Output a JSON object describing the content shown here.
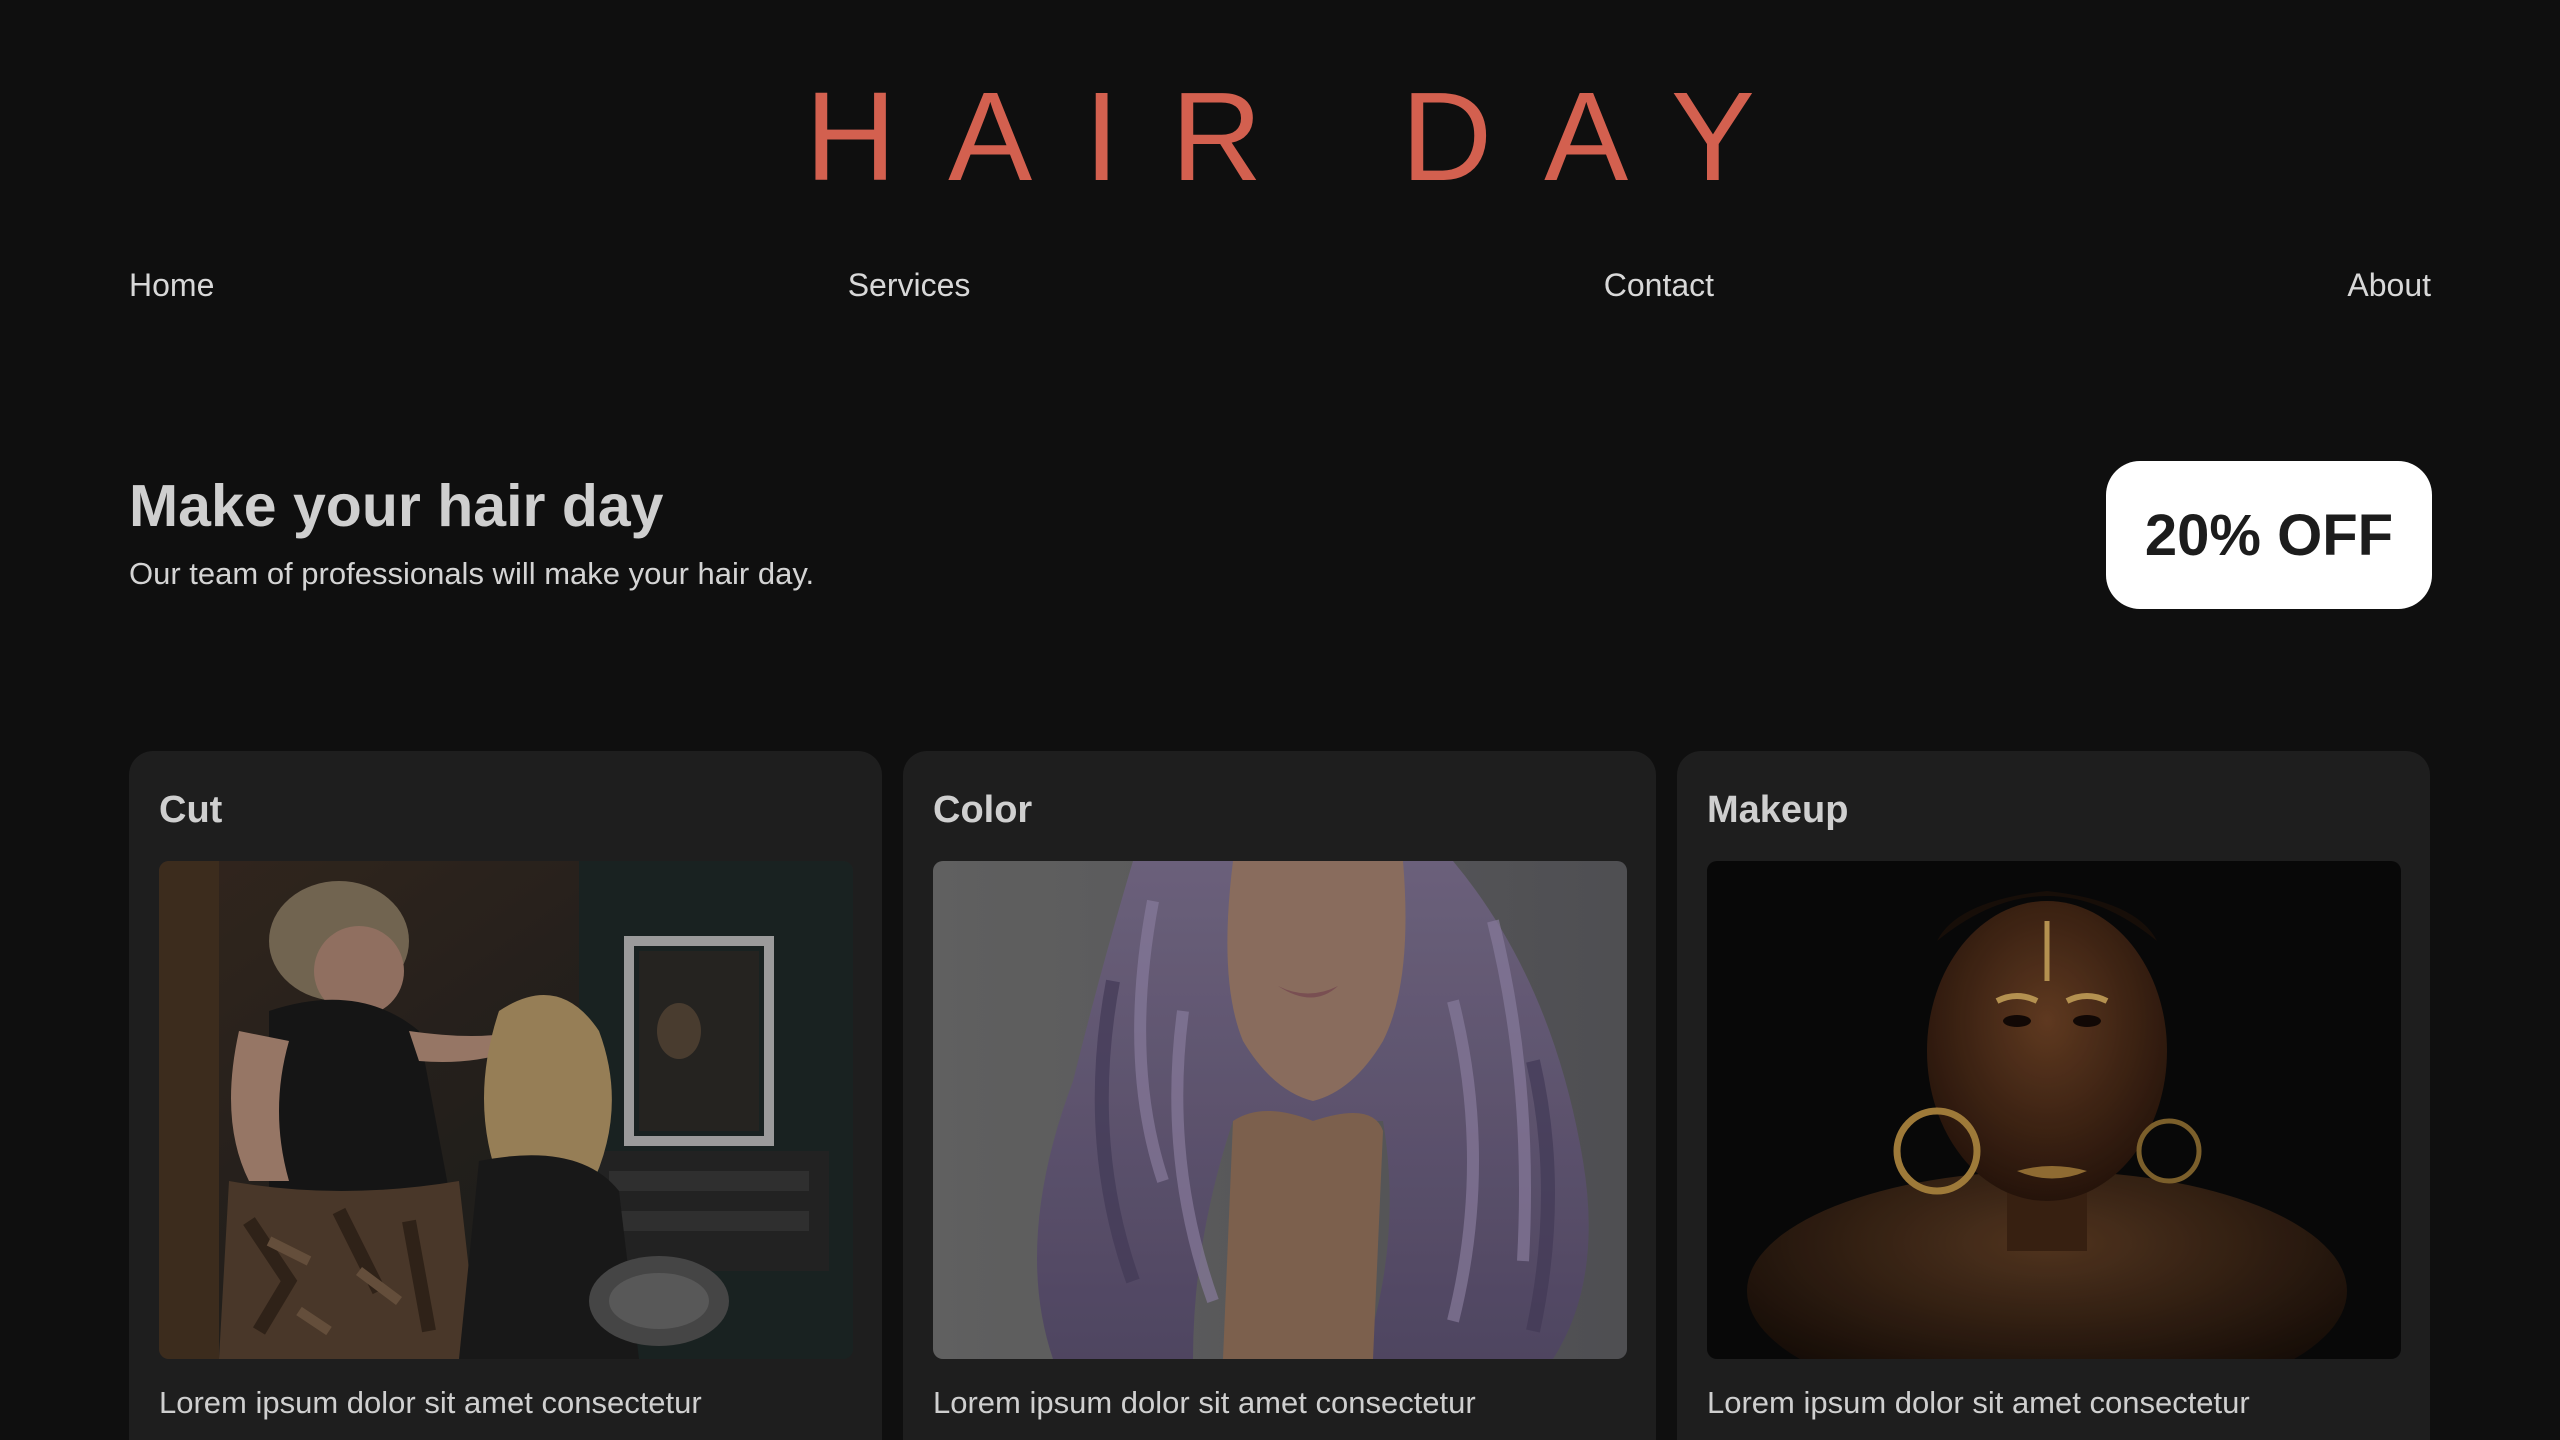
{
  "brand": {
    "logo": "HAIR DAY",
    "accent_color": "#d3604f"
  },
  "nav": {
    "items": [
      "Home",
      "Services",
      "Contact",
      "About"
    ]
  },
  "hero": {
    "title": "Make your hair day",
    "subtitle": "Our team of professionals will make your hair day."
  },
  "promo": {
    "label": "20% OFF"
  },
  "services": [
    {
      "title": "Cut",
      "description": "Lorem ipsum dolor sit amet consectetur",
      "image_icon": "hairstylist-photo"
    },
    {
      "title": "Color",
      "description": "Lorem ipsum dolor sit amet consectetur",
      "image_icon": "lavender-hair-photo"
    },
    {
      "title": "Makeup",
      "description": "Lorem ipsum dolor sit amet consectetur",
      "image_icon": "gold-makeup-photo"
    }
  ]
}
